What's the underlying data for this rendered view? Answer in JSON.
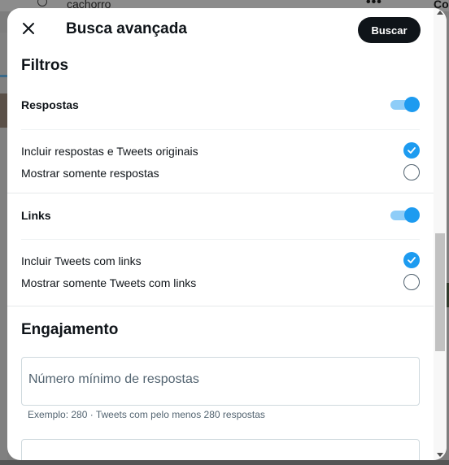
{
  "background": {
    "search_query": "cachorro",
    "more_icon": "more-icon",
    "right_text": "Co"
  },
  "dialog": {
    "title": "Busca avançada",
    "close_icon": "close-icon",
    "search_button": "Buscar"
  },
  "filters": {
    "heading": "Filtros",
    "replies": {
      "label": "Respostas",
      "enabled": true,
      "options": [
        {
          "label": "Incluir respostas e Tweets originais",
          "selected": true
        },
        {
          "label": "Mostrar somente respostas",
          "selected": false
        }
      ]
    },
    "links": {
      "label": "Links",
      "enabled": true,
      "options": [
        {
          "label": "Incluir Tweets com links",
          "selected": true
        },
        {
          "label": "Mostrar somente Tweets com links",
          "selected": false
        }
      ]
    }
  },
  "engagement": {
    "heading": "Engajamento",
    "min_replies": {
      "placeholder": "Número mínimo de respostas",
      "value": "",
      "hint": "Exemplo: 280 · Tweets com pelo menos 280 respostas"
    }
  },
  "colors": {
    "accent": "#1d9bf0",
    "accent_light": "#8ecdf8",
    "button_bg": "#0f1419",
    "text_primary": "#0f1419",
    "text_secondary": "#536471"
  }
}
